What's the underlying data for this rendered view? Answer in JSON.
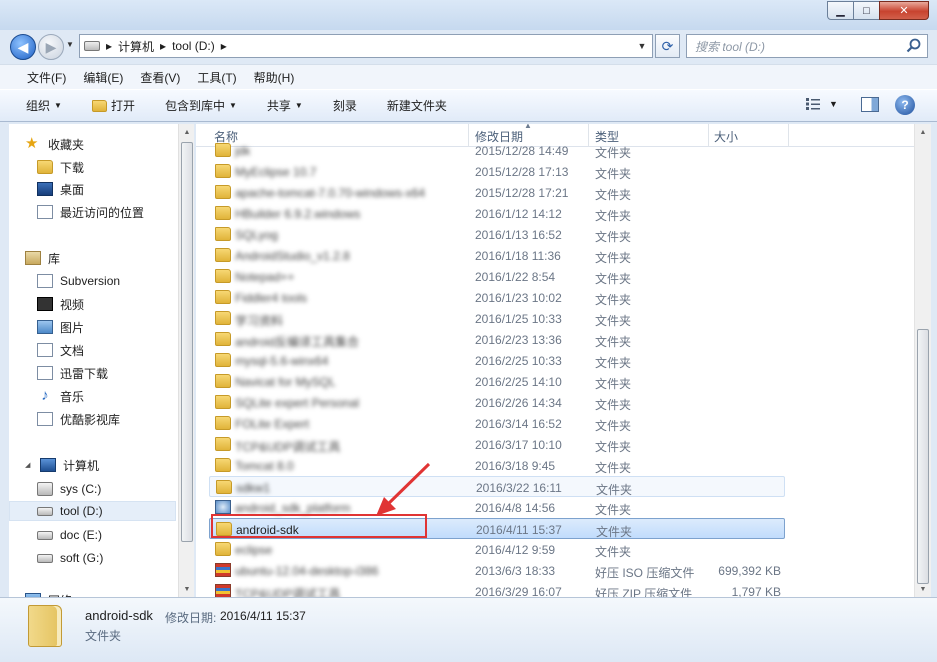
{
  "window": {
    "minimize": "▁",
    "maximize": "□",
    "close": "✕"
  },
  "address": {
    "crumbs": [
      "计算机",
      "tool (D:)"
    ],
    "separator": "▸",
    "search_placeholder": "搜索 tool (D:)"
  },
  "menu": [
    "文件(F)",
    "编辑(E)",
    "查看(V)",
    "工具(T)",
    "帮助(H)"
  ],
  "toolbar": {
    "organize": "组织",
    "open": "打开",
    "include": "包含到库中",
    "share": "共享",
    "burn": "刻录",
    "new_folder": "新建文件夹"
  },
  "nav": {
    "favorites": "收藏夹",
    "downloads": "下载",
    "desktop": "桌面",
    "recent": "最近访问的位置",
    "libraries": "库",
    "subversion": "Subversion",
    "videos": "视频",
    "pictures": "图片",
    "documents": "文档",
    "thunder": "迅雷下载",
    "music": "音乐",
    "youku": "优酷影视库",
    "computer": "计算机",
    "drive_c": "sys (C:)",
    "drive_d": "tool (D:)",
    "drive_e": "doc (E:)",
    "drive_g": "soft (G:)",
    "network": "网络"
  },
  "columns": {
    "name": "名称",
    "date": "修改日期",
    "type": "类型",
    "size": "大小"
  },
  "files": [
    {
      "name": "jdk",
      "date": "2015/12/28 14:49",
      "type": "文件夹",
      "size": "",
      "blur": true
    },
    {
      "name": "MyEclipse 10.7",
      "date": "2015/12/28 17:13",
      "type": "文件夹",
      "size": "",
      "blur": true
    },
    {
      "name": "apache-tomcat-7.0.70-windows-x64",
      "date": "2015/12/28 17:21",
      "type": "文件夹",
      "size": "",
      "blur": true
    },
    {
      "name": "HBuilder 6.9.2.windows",
      "date": "2016/1/12 14:12",
      "type": "文件夹",
      "size": "",
      "blur": true
    },
    {
      "name": "SQLyog",
      "date": "2016/1/13 16:52",
      "type": "文件夹",
      "size": "",
      "blur": true
    },
    {
      "name": "AndroidStudio_v1.2.8",
      "date": "2016/1/18 11:36",
      "type": "文件夹",
      "size": "",
      "blur": true
    },
    {
      "name": "Notepad++",
      "date": "2016/1/22 8:54",
      "type": "文件夹",
      "size": "",
      "blur": true
    },
    {
      "name": "Fiddler4 tools",
      "date": "2016/1/23 10:02",
      "type": "文件夹",
      "size": "",
      "blur": true
    },
    {
      "name": "学习资料",
      "date": "2016/1/25 10:33",
      "type": "文件夹",
      "size": "",
      "blur": true
    },
    {
      "name": "android反编译工具集合",
      "date": "2016/2/23 13:36",
      "type": "文件夹",
      "size": "",
      "blur": true
    },
    {
      "name": "mysql-5.6-winx64",
      "date": "2016/2/25 10:33",
      "type": "文件夹",
      "size": "",
      "blur": true
    },
    {
      "name": "Navicat for MySQL",
      "date": "2016/2/25 14:10",
      "type": "文件夹",
      "size": "",
      "blur": true
    },
    {
      "name": "SQLite expert Personal",
      "date": "2016/2/26 14:34",
      "type": "文件夹",
      "size": "",
      "blur": true
    },
    {
      "name": "FOLite Expert",
      "date": "2016/3/14 16:52",
      "type": "文件夹",
      "size": "",
      "blur": true
    },
    {
      "name": "TCP&UDP调试工具",
      "date": "2016/3/17 10:10",
      "type": "文件夹",
      "size": "",
      "blur": true
    },
    {
      "name": "Tomcat 8.0",
      "date": "2016/3/18 9:45",
      "type": "文件夹",
      "size": "",
      "blur": true
    },
    {
      "name": "sdkw1",
      "date": "2016/3/22 16:11",
      "type": "文件夹",
      "size": "",
      "blur": true
    },
    {
      "name": "android_sdk_platform",
      "date": "2016/4/8 14:56",
      "type": "文件夹",
      "size": "",
      "blur": true
    },
    {
      "name": "android-sdk",
      "date": "2016/4/11 15:37",
      "type": "文件夹",
      "size": "",
      "blur": false
    },
    {
      "name": "eclipse",
      "date": "2016/4/12 9:59",
      "type": "文件夹",
      "size": "",
      "blur": true
    },
    {
      "name": "ubuntu-12.04-desktop-i386",
      "date": "2013/6/3 18:33",
      "type": "好压 ISO 压缩文件",
      "size": "699,392 KB",
      "blur": true
    },
    {
      "name": "TCP&UDP调试工具",
      "date": "2016/3/29 16:07",
      "type": "好压 ZIP 压缩文件",
      "size": "1,797 KB",
      "blur": true
    }
  ],
  "details": {
    "name": "android-sdk",
    "date_label": "修改日期:",
    "date": "2016/4/11 15:37",
    "type": "文件夹"
  }
}
